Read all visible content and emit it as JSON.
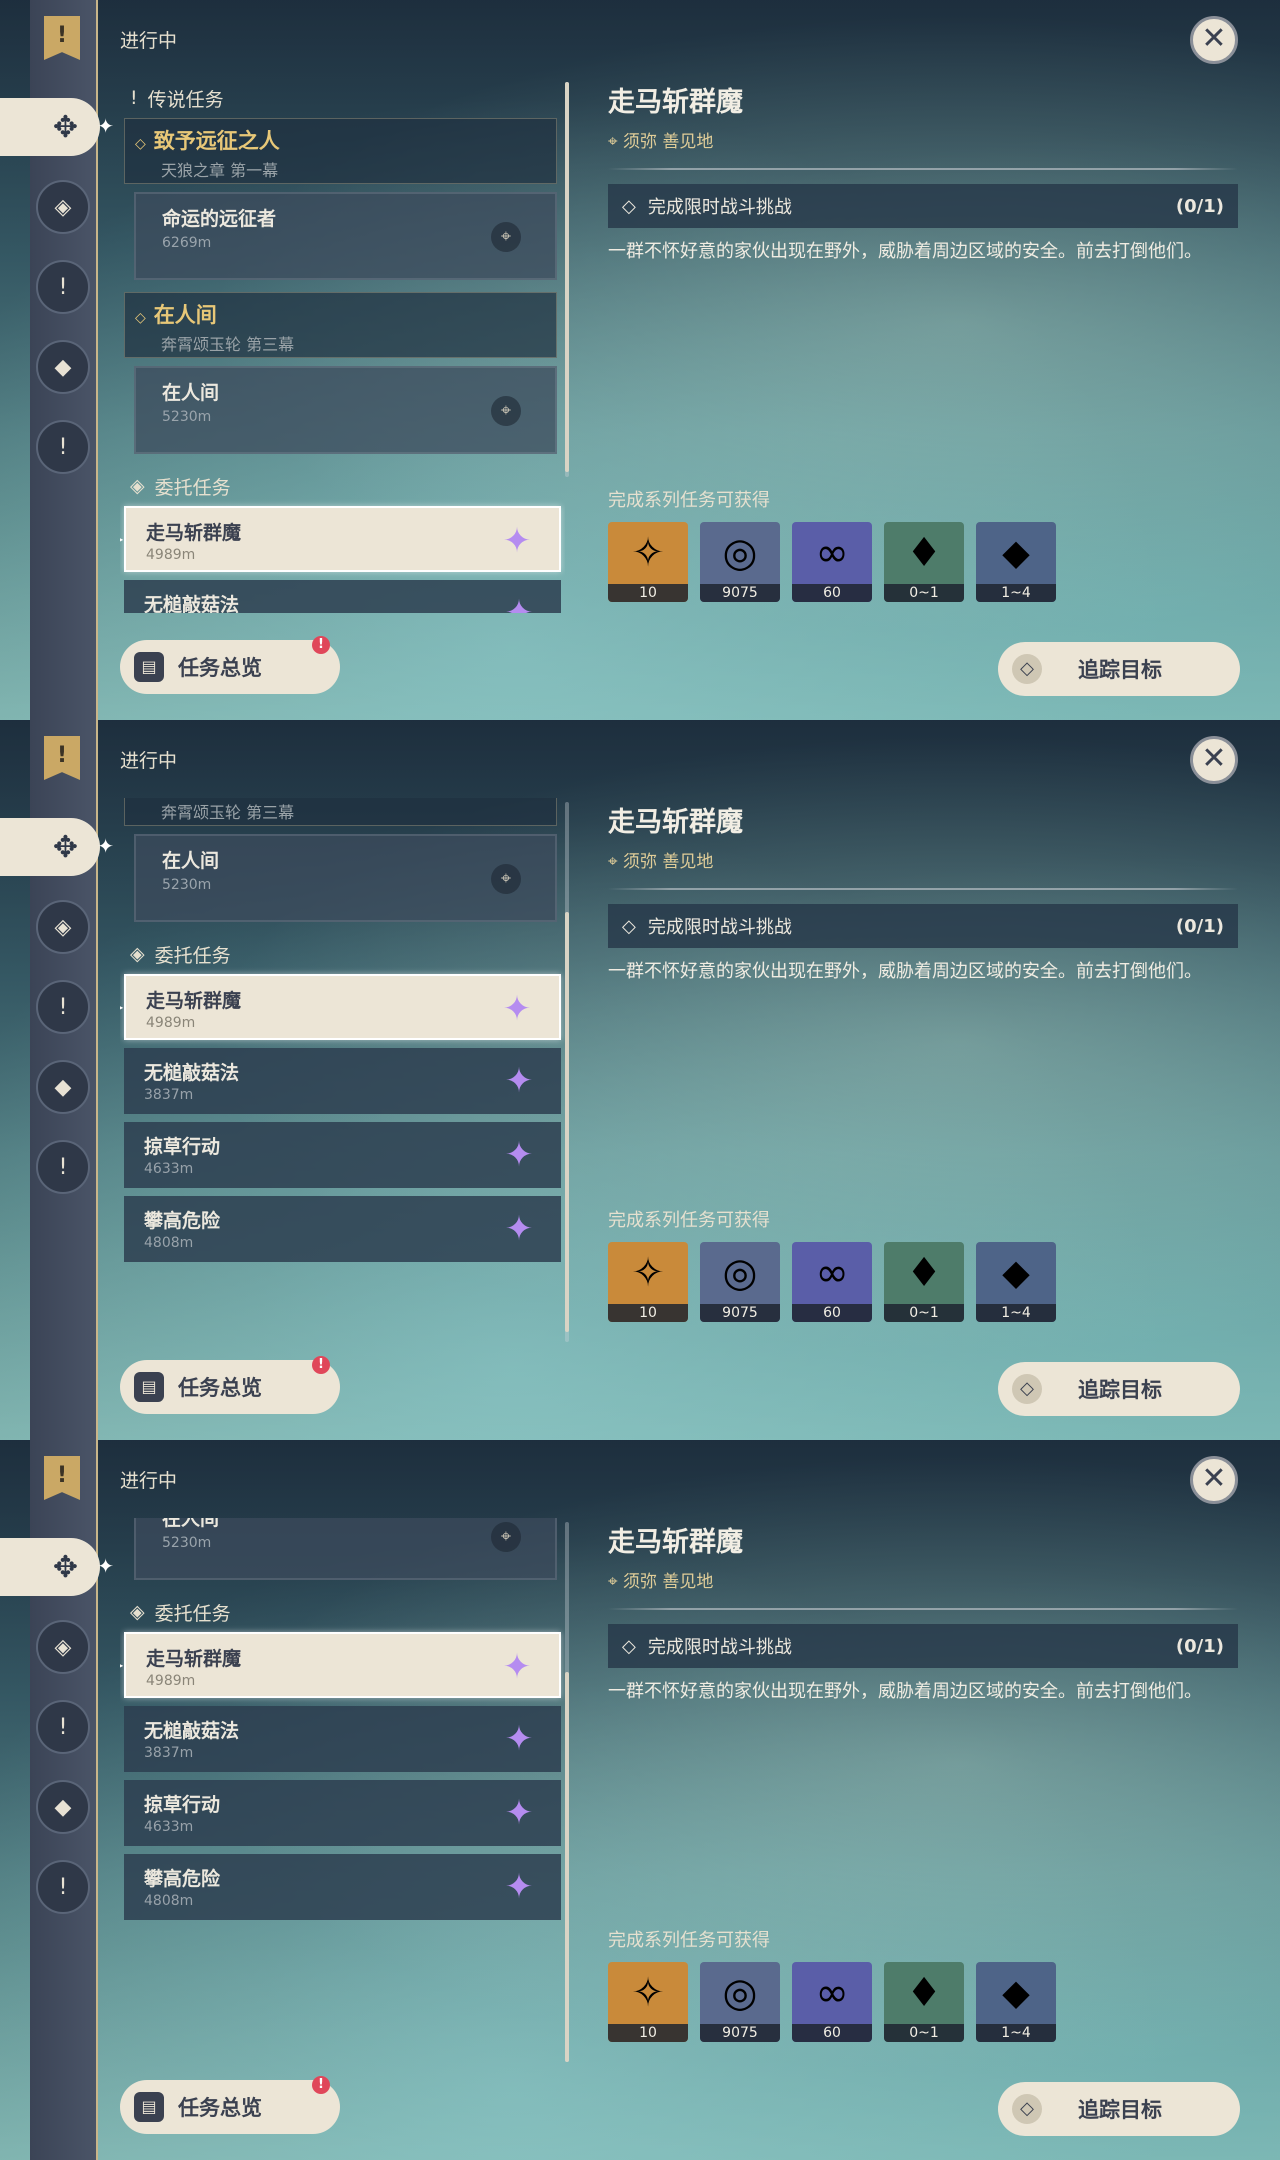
{
  "header": {
    "in_progress_label": "进行中"
  },
  "icons": {
    "close": "close-icon",
    "quest_marker": "exclamation-icon",
    "commission": "commission-diamond-icon"
  },
  "sections": {
    "legend": "传说任务",
    "commission": "委托任务"
  },
  "legend_quests": [
    {
      "title": "致予远征之人",
      "subtitle": "天狼之章 第一幕",
      "step": "命运的远征者",
      "distance": "6269m"
    },
    {
      "title": "在人间",
      "subtitle": "奔霄颂玉轮 第三幕",
      "step": "在人间",
      "distance": "5230m"
    }
  ],
  "commissions": [
    {
      "title": "走马斩群魔",
      "distance": "4989m"
    },
    {
      "title": "无槌敲菇法",
      "distance": "3837m"
    },
    {
      "title": "掠草行动",
      "distance": "4633m"
    },
    {
      "title": "攀高危险",
      "distance": "4808m"
    }
  ],
  "detail": {
    "title": "走马斩群魔",
    "location": "须弥 善见地",
    "objective": "完成限时战斗挑战",
    "objective_progress": "(0/1)",
    "description": "一群不怀好意的家伙出现在野外，威胁着周边区域的安全。前去打倒他们。"
  },
  "rewards": {
    "heading": "完成系列任务可获得",
    "items": [
      {
        "icon": "primogem-icon",
        "count": "10",
        "color": "#c98a3a"
      },
      {
        "icon": "mora-icon",
        "count": "9075",
        "color": "#5a6a8e"
      },
      {
        "icon": "companionship-exp-icon",
        "count": "60",
        "color": "#5a5ea8"
      },
      {
        "icon": "crystal-chunk-icon",
        "count": "0~1",
        "color": "#4e7c6a"
      },
      {
        "icon": "crystal-cluster-icon",
        "count": "1~4",
        "color": "#4e6488"
      }
    ]
  },
  "buttons": {
    "overview": "任务总览",
    "overview_badge": "!",
    "track": "追踪目标"
  }
}
